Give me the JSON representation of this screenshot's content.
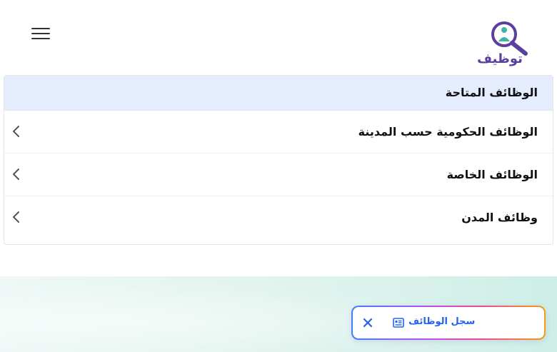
{
  "header": {
    "menu_icon": "hamburger-menu-icon",
    "logo_icon": "magnifier-person-logo",
    "logo_text": "توظيف"
  },
  "panel": {
    "title": "الوظائف المتاحة",
    "items": [
      {
        "label": "الوظائف الحكومية حسب المدينة",
        "icon": "chevron-left-icon"
      },
      {
        "label": "الوظائف الخاصة",
        "icon": "chevron-left-icon"
      },
      {
        "label": "وظائف المدن",
        "icon": "chevron-left-icon"
      }
    ]
  },
  "floating": {
    "label": "سجل الوظائف",
    "close_icon": "close-icon",
    "list_icon": "list-card-icon"
  },
  "colors": {
    "panel_header_bg": "#e4ecfd",
    "accent_blue": "#2563eb",
    "footer_bg": "#d6f1ea"
  }
}
